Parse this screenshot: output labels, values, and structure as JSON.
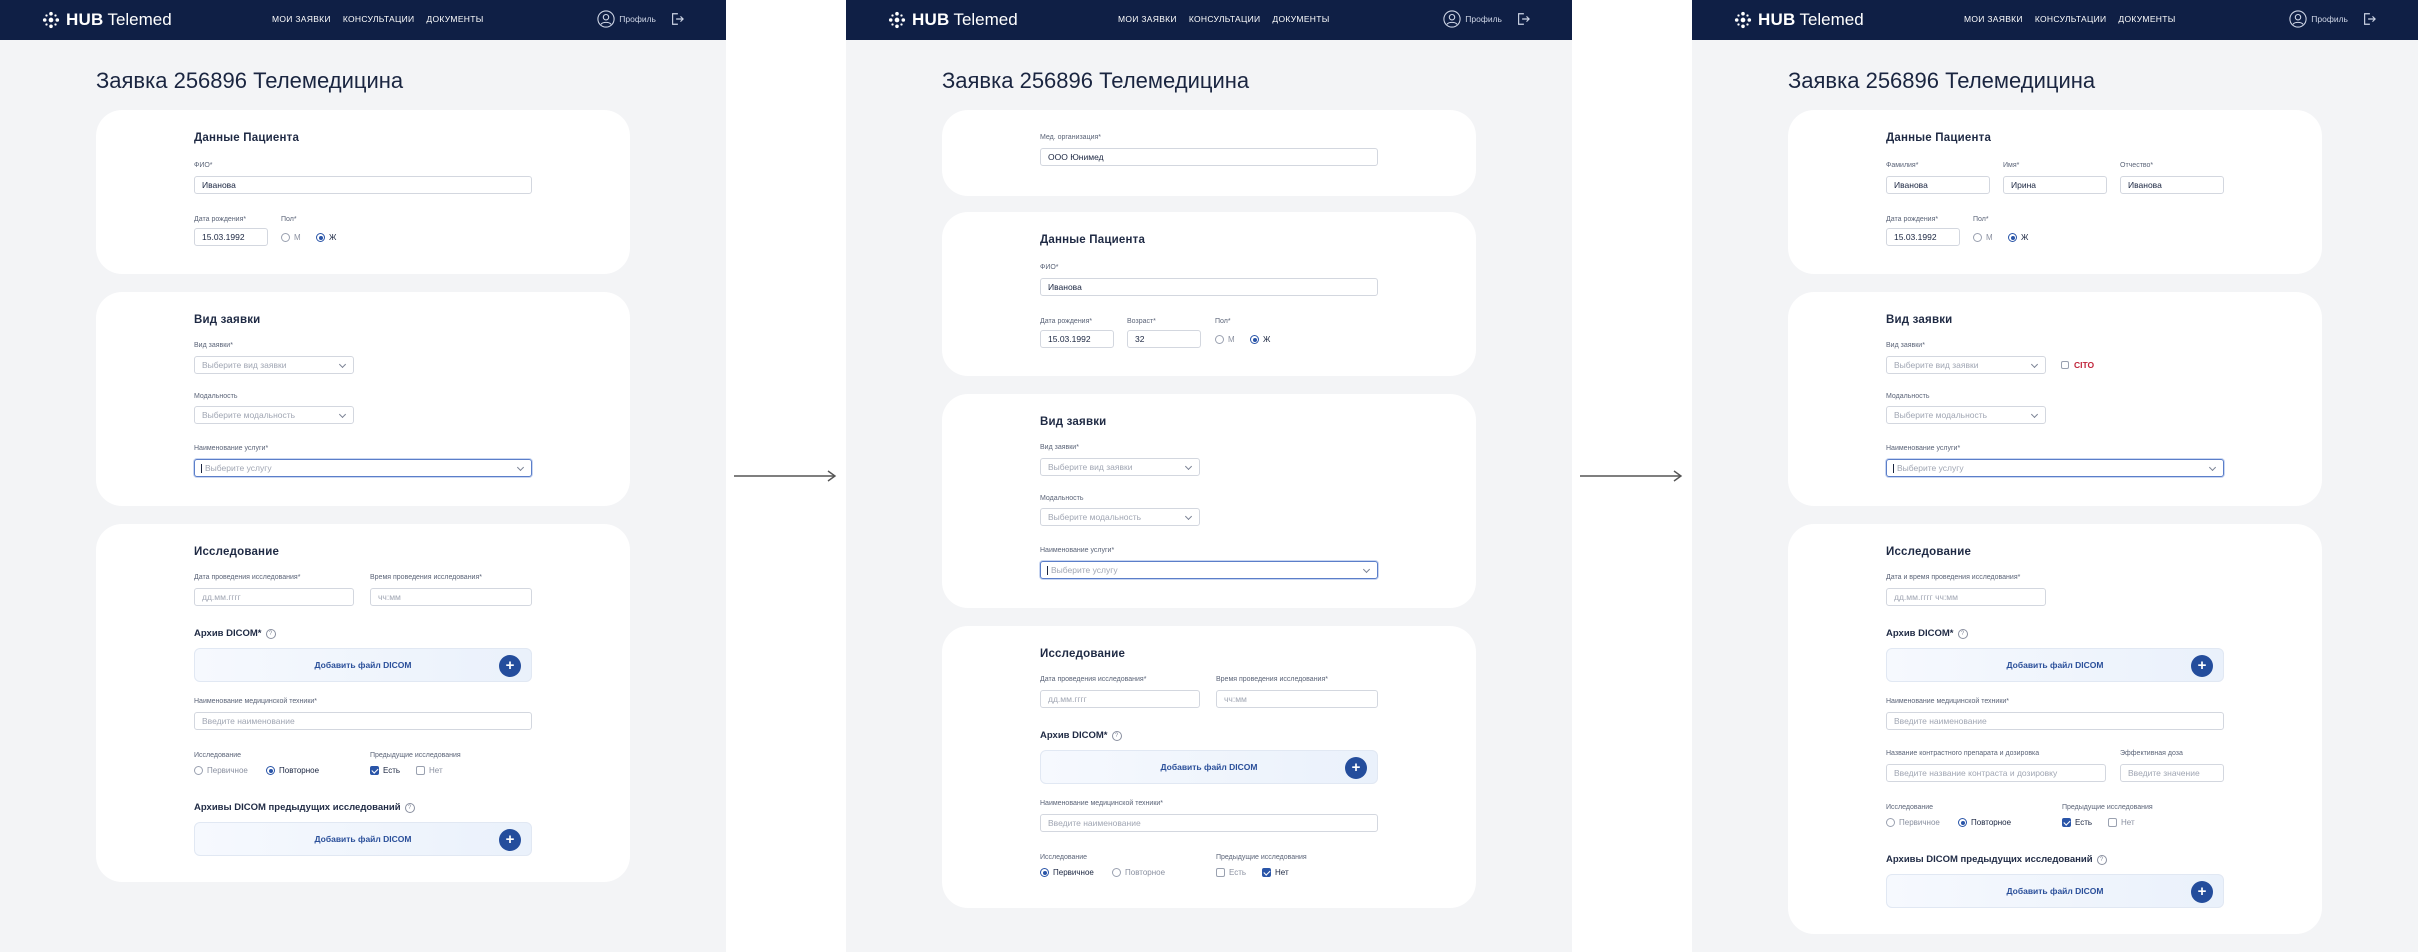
{
  "brand": {
    "hub": "HUB",
    "name": "Telemed"
  },
  "nav": [
    "МОИ ЗАЯВКИ",
    "КОНСУЛЬТАЦИИ",
    "ДОКУМЕНТЫ"
  ],
  "profile": "Профиль",
  "title": "Заявка 256896 Телемедицина",
  "org": {
    "label": "Мед. организация*",
    "value": "ООО Юнимед"
  },
  "patient": {
    "title": "Данные  Пациента",
    "fio_label": "ФИО*",
    "fio_value": "Иванова",
    "surname_label": "Фамилия*",
    "surname_value": "Иванова",
    "name_label": "Имя*",
    "name_value": "Ирина",
    "patronymic_label": "Отчество*",
    "patronymic_value": "Иванова",
    "dob_label": "Дата рождения*",
    "dob_value": "15.03.1992",
    "age_label": "Возраст*",
    "age_value": "32",
    "sex_label": "Пол*",
    "sex_m": "М",
    "sex_f": "Ж"
  },
  "request": {
    "title": "Вид заявки",
    "type_label": "Вид заявки*",
    "type_ph": "Выберите вид заявки",
    "cito": "CITO",
    "modality_label": "Модальность",
    "modality_ph": "Выберите модальность",
    "service_label": "Наименование услуги*",
    "service_ph": "Выберите услугу"
  },
  "study": {
    "title": "Исследование",
    "date_label": "Дата проведения исследования*",
    "date_ph": "дд.мм.гггг",
    "time_label": "Время проведения исследования*",
    "time_ph": "чч:мм",
    "datetime_label": "Дата и время  проведения исследования*",
    "datetime_ph": "дд.мм.гггг чч:мм",
    "dicom_label": "Архив DICOM*",
    "help": "?",
    "add_dicom": "Добавить файл DICOM",
    "equipment_label": "Наименование медицинской техники*",
    "equipment_ph": "Введите наименование",
    "contrast_label": "Название контрастного препарата и дозировка",
    "contrast_ph": "Введите название контраста и дозировку",
    "dose_label": "Эффективная доза",
    "dose_ph": "Введите значение",
    "kind_label": "Исследование",
    "kind_primary": "Первичное",
    "kind_repeat": "Повторное",
    "prev_label": "Предыдущие исследования",
    "prev_yes": "Есть",
    "prev_no": "Нет",
    "prev_archives": "Архивы DICOM предыдущих исследований",
    "plus": "+"
  },
  "colors": {
    "header": "#0f1f45",
    "accent": "#244d9c",
    "cito": "#c0243a",
    "panel_bg": "#f3f4f6"
  }
}
